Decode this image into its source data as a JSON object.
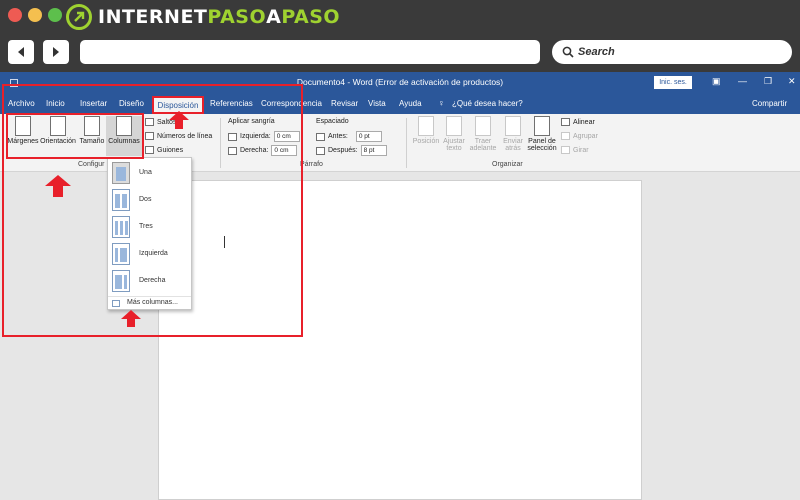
{
  "browser": {
    "logo_part1": "INTERNET",
    "logo_part2": "PASO",
    "logo_part3": "A",
    "logo_part4": "PASO",
    "search_label": "Search",
    "colors": {
      "chrome": "#3a3a3a",
      "close": "#ee5b53",
      "minimize": "#f4bf4f",
      "maximize": "#5dbf4c",
      "brand_green": "#9fd230"
    },
    "icons": [
      "back-arrow-icon",
      "forward-arrow-icon",
      "search-icon"
    ]
  },
  "word": {
    "title": "Documento4 - Word (Error de activación de productos)",
    "signin": "Inic. ses.",
    "window_controls": [
      "restore-ribbon-icon",
      "minimize-icon",
      "maximize-icon",
      "close-icon"
    ],
    "tabs": [
      "Archivo",
      "Inicio",
      "Insertar",
      "Diseño",
      "Disposición",
      "Referencias",
      "Correspondencia",
      "Revisar",
      "Vista",
      "Ayuda"
    ],
    "active_tab": "Disposición",
    "tell_me": "¿Qué desea hacer?",
    "share": "Compartir",
    "brand_color": "#2b579a"
  },
  "ribbon": {
    "page_setup": {
      "margins": "Márgenes",
      "orientation": "Orientación",
      "size": "Tamaño",
      "columns": "Columnas",
      "breaks": "Saltos",
      "line_numbers": "Números de línea",
      "hyphenation": "Guiones",
      "group_label": "Configur"
    },
    "paragraph": {
      "indent_title": "Aplicar sangría",
      "left_label": "Izquierda:",
      "left_value": "0 cm",
      "right_label": "Derecha:",
      "right_value": "0 cm",
      "spacing_title": "Espaciado",
      "before_label": "Antes:",
      "before_value": "0 pt",
      "after_label": "Después:",
      "after_value": "8 pt",
      "group_label": "Párrafo"
    },
    "arrange": {
      "position": "Posición",
      "wrap_line1": "Ajustar",
      "wrap_line2": "texto",
      "forward_line1": "Traer",
      "forward_line2": "adelante",
      "backward_line1": "Enviar",
      "backward_line2": "atrás",
      "selection_line1": "Panel de",
      "selection_line2": "selección",
      "align": "Alinear",
      "group": "Agrupar",
      "rotate": "Girar",
      "group_label": "Organizar"
    }
  },
  "columns_menu": {
    "items": [
      "Una",
      "Dos",
      "Tres",
      "Izquierda",
      "Derecha"
    ],
    "selected": "Una",
    "more": "Más columnas..."
  },
  "annotation_color": "#e8202a"
}
